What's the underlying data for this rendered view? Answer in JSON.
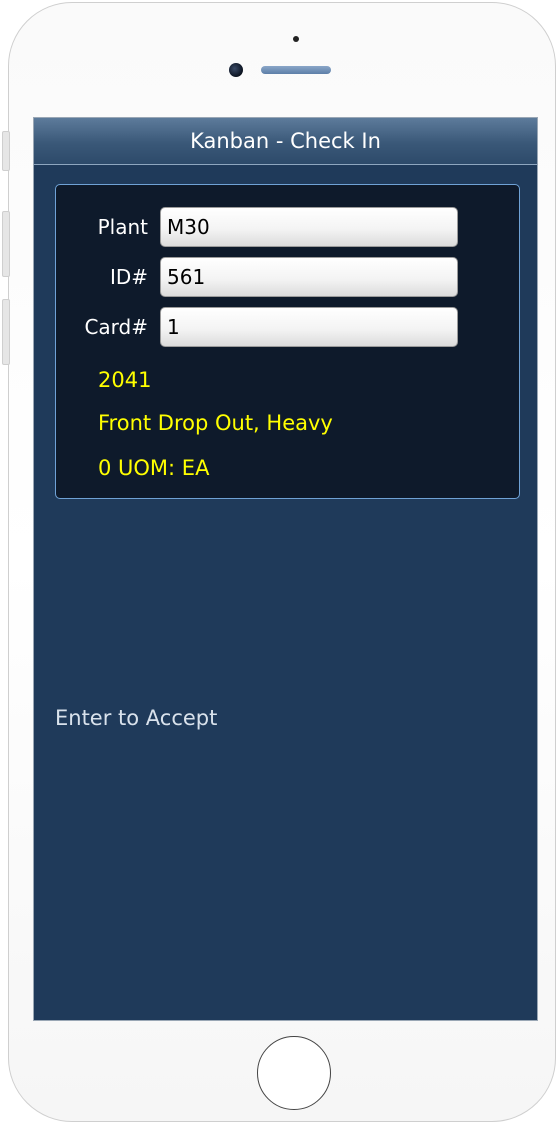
{
  "header": {
    "title": "Kanban - Check In"
  },
  "form": {
    "plant_label": "Plant",
    "plant_value": "M30",
    "id_label": "ID#",
    "id_value": "561",
    "card_label": "Card#",
    "card_value": "1"
  },
  "item": {
    "number": "2041",
    "description": "Front Drop Out, Heavy",
    "quantity": "0 UOM: EA"
  },
  "prompt": "Enter to Accept",
  "colors": {
    "screen_bg": "#1f3a5a",
    "panel_bg": "#0e1a2b",
    "highlight_text": "#ffff00"
  }
}
